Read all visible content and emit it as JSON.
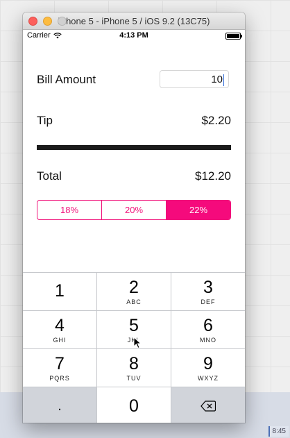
{
  "window": {
    "title": "iPhone 5 - iPhone 5 / iOS 9.2 (13C75)"
  },
  "status_bar": {
    "carrier": "Carrier",
    "time": "4:13 PM"
  },
  "bill": {
    "label": "Bill Amount",
    "value": "10"
  },
  "tip": {
    "label": "Tip",
    "value": "$2.20"
  },
  "total": {
    "label": "Total",
    "value": "$12.20"
  },
  "tip_options": [
    "18%",
    "20%",
    "22%"
  ],
  "tip_selected": "22%",
  "keypad": {
    "rows": [
      [
        {
          "digit": "1",
          "letters": ""
        },
        {
          "digit": "2",
          "letters": "ABC"
        },
        {
          "digit": "3",
          "letters": "DEF"
        }
      ],
      [
        {
          "digit": "4",
          "letters": "GHI"
        },
        {
          "digit": "5",
          "letters": "JKL"
        },
        {
          "digit": "6",
          "letters": "MNO"
        }
      ],
      [
        {
          "digit": "7",
          "letters": "PQRS"
        },
        {
          "digit": "8",
          "letters": "TUV"
        },
        {
          "digit": "9",
          "letters": "WXYZ"
        }
      ]
    ],
    "decimal": ".",
    "zero": "0"
  },
  "backdrop": {
    "clock": "8:45"
  },
  "colors": {
    "accent": "#f50a7c"
  }
}
